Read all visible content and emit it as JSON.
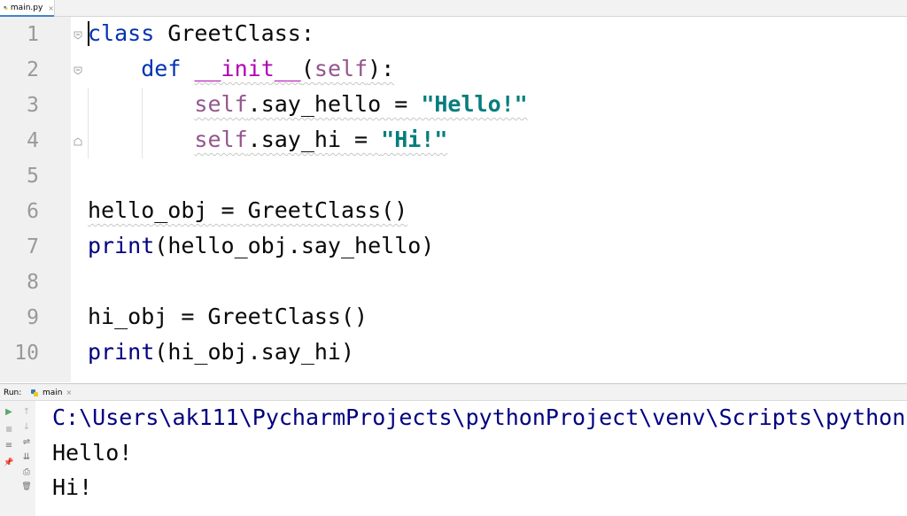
{
  "tab": {
    "filename": "main.py",
    "close": "×"
  },
  "editor": {
    "lines": [
      {
        "no": "1"
      },
      {
        "no": "2"
      },
      {
        "no": "3"
      },
      {
        "no": "4"
      },
      {
        "no": "5"
      },
      {
        "no": "6"
      },
      {
        "no": "7"
      },
      {
        "no": "8"
      },
      {
        "no": "9"
      },
      {
        "no": "10"
      }
    ],
    "tokens": {
      "l1_kw": "class",
      "l1_rest": " GreetClass:",
      "l2_kw": "def",
      "l2_magic": "__init__",
      "l2_open": "(",
      "l2_self": "self",
      "l2_close": "):",
      "l3_self": "self",
      "l3_mid": ".say_hello = ",
      "l3_str": "\"Hello!\"",
      "l4_self": "self",
      "l4_mid": ".say_hi = ",
      "l4_str": "\"Hi!\"",
      "l6": "hello_obj = GreetClass()",
      "l7_fn": "print",
      "l7_rest": "(hello_obj.say_hello)",
      "l9": "hi_obj = GreetClass()",
      "l10_fn": "print",
      "l10_rest": "(hi_obj.say_hi)"
    }
  },
  "run": {
    "label": "Run:",
    "tab": "main",
    "close": "×",
    "output": [
      "C:\\Users\\ak111\\PycharmProjects\\pythonProject\\venv\\Scripts\\python",
      "Hello!",
      "Hi!"
    ]
  },
  "icons": {
    "rerun": "▶",
    "stop": "■",
    "layout": "≡",
    "pin": "📌",
    "up": "↑",
    "down": "↓",
    "wrap": "⇌",
    "sort": "⇊",
    "print": "⎙",
    "trash": "🗑"
  },
  "colors": {
    "keyword": "#0033b3",
    "self": "#94558d",
    "magic": "#b200b2",
    "string": "#067d7d",
    "builtin": "#000080",
    "gutter": "#f0f0f0"
  }
}
